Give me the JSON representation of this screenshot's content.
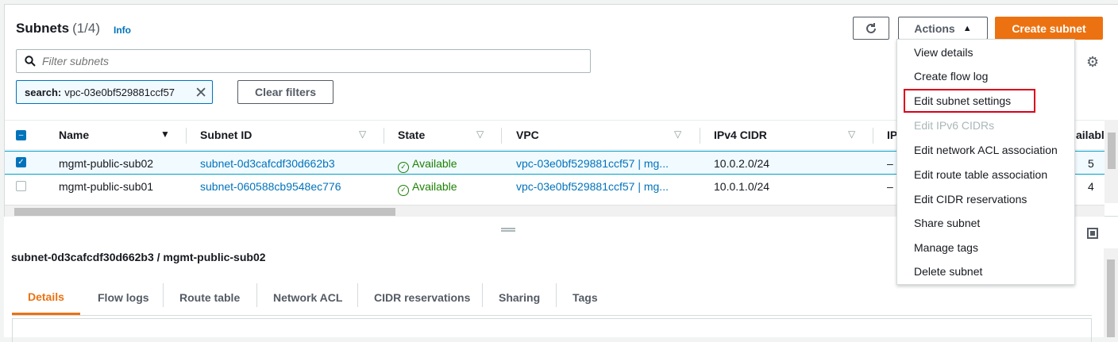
{
  "header": {
    "title": "Subnets",
    "count": "(1/4)",
    "info": "Info",
    "actions_label": "Actions",
    "create_label": "Create subnet"
  },
  "search": {
    "placeholder": "Filter subnets",
    "token_key": "search:",
    "token_value": "vpc-03e0bf529881ccf57",
    "clear_label": "Clear filters"
  },
  "table": {
    "columns": [
      "Name",
      "Subnet ID",
      "State",
      "VPC",
      "IPv4 CIDR",
      "IP",
      "ailabl"
    ],
    "rows": [
      {
        "selected": true,
        "name": "mgmt-public-sub02",
        "subnet_id": "subnet-0d3cafcdf30d662b3",
        "state": "Available",
        "vpc": "vpc-03e0bf529881ccf57 | mg...",
        "cidr": "10.0.2.0/24",
        "ipv6": "–",
        "avail": "5"
      },
      {
        "selected": false,
        "name": "mgmt-public-sub01",
        "subnet_id": "subnet-060588cb9548ec776",
        "state": "Available",
        "vpc": "vpc-03e0bf529881ccf57 | mg...",
        "cidr": "10.0.1.0/24",
        "ipv6": "–",
        "avail": "4"
      }
    ]
  },
  "details": {
    "title": "subnet-0d3cafcdf30d662b3 / mgmt-public-sub02",
    "tabs": [
      "Details",
      "Flow logs",
      "Route table",
      "Network ACL",
      "CIDR reservations",
      "Sharing",
      "Tags"
    ]
  },
  "menu": {
    "items": [
      {
        "label": "View details",
        "disabled": false
      },
      {
        "label": "Create flow log",
        "disabled": false
      },
      {
        "label": "Edit subnet settings",
        "disabled": false,
        "highlighted": true
      },
      {
        "label": "Edit IPv6 CIDRs",
        "disabled": true
      },
      {
        "label": "Edit network ACL association",
        "disabled": false
      },
      {
        "label": "Edit route table association",
        "disabled": false
      },
      {
        "label": "Edit CIDR reservations",
        "disabled": false
      },
      {
        "label": "Share subnet",
        "disabled": false
      },
      {
        "label": "Manage tags",
        "disabled": false
      },
      {
        "label": "Delete subnet",
        "disabled": false
      }
    ]
  },
  "colors": {
    "accent": "#ec7211",
    "link": "#0073bb",
    "success": "#1d8102",
    "highlight_box": "#d9001b"
  }
}
